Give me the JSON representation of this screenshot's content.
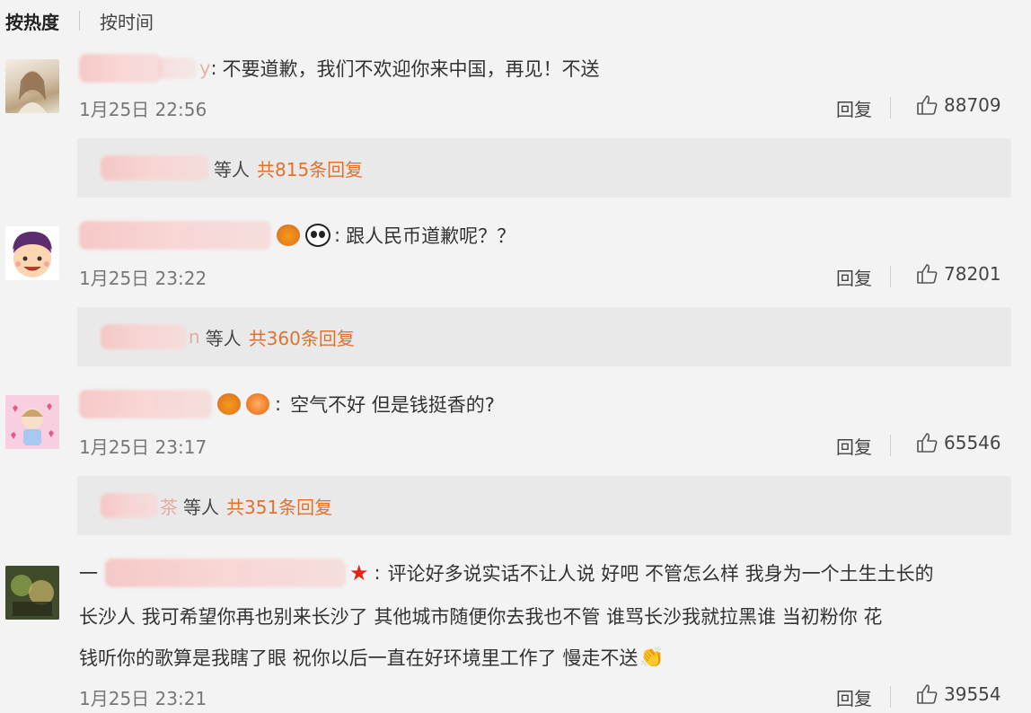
{
  "tabs": {
    "hot": "按热度",
    "time": "按时间"
  },
  "comments": [
    {
      "name_tail": "y",
      "text": "不要道歉，我们不欢迎你来中国，再见！不送",
      "date": "1月25日 22:56",
      "reply_label": "回复",
      "likes": "88709",
      "replies_people": "等人",
      "replies_count": "共815条回复"
    },
    {
      "name_tail": "",
      "text": "跟人民币道歉呢？？",
      "date": "1月25日 23:22",
      "reply_label": "回复",
      "likes": "78201",
      "replies_tail": "n",
      "replies_people": "等人",
      "replies_count": "共360条回复"
    },
    {
      "name_tail": "",
      "text": "空气不好 但是钱挺香的?",
      "date": "1月25日 23:17",
      "reply_label": "回复",
      "likes": "65546",
      "replies_tail": "茶",
      "replies_people": "等人",
      "replies_count": "共351条回复"
    },
    {
      "name_prefix": "一",
      "line1": "评论好多说实话不让人说 好吧 不管怎么样 我身为一个土生土长的",
      "line2": "长沙人 我可希望你再也别来长沙了 其他城市随便你去我也不管 谁骂长沙我就拉黑谁 当初粉你 花",
      "line3": "钱听你的歌算是我瞎了眼 祝你以后一直在好环境里工作了 慢走不送",
      "date": "1月25日 23:21",
      "reply_label": "回复",
      "likes": "39554"
    }
  ],
  "colors": {
    "accent_orange": "#e1712b",
    "reply_bg": "#e9e9e9",
    "page_bg": "#f3f3f3"
  }
}
